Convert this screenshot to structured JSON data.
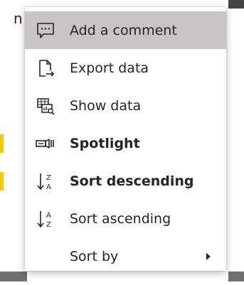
{
  "background": {
    "partial_text": "n"
  },
  "menu": {
    "items": [
      {
        "label": "Add a comment",
        "icon": "comment-icon",
        "state": "hover",
        "bold": false,
        "active": false
      },
      {
        "label": "Export data",
        "icon": "export-icon",
        "state": "normal",
        "bold": false,
        "active": false
      },
      {
        "label": "Show data",
        "icon": "show-data-icon",
        "state": "normal",
        "bold": false,
        "active": false
      },
      {
        "label": "Spotlight",
        "icon": "spotlight-icon",
        "state": "normal",
        "bold": true,
        "active": true
      },
      {
        "label": "Sort descending",
        "icon": "sort-descending-icon",
        "state": "normal",
        "bold": true,
        "active": true
      },
      {
        "label": "Sort ascending",
        "icon": "sort-ascending-icon",
        "state": "normal",
        "bold": false,
        "active": false
      },
      {
        "label": "Sort by",
        "icon": "",
        "state": "normal",
        "bold": false,
        "active": false,
        "submenu": true
      }
    ]
  },
  "colors": {
    "hover_background": "#c8c6c4",
    "active_indicator": "#f2c811",
    "text": "#252423"
  }
}
